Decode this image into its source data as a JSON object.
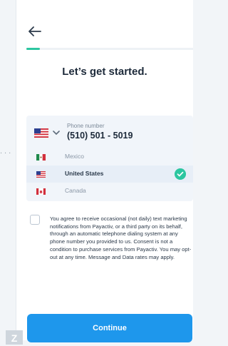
{
  "header": {
    "title": "Let’s get started."
  },
  "progress": {
    "fraction": 0.08
  },
  "phone": {
    "label": "Phone number",
    "value": "(510) 501 - 5019",
    "selected_flag": "us-flag-icon"
  },
  "countries": [
    {
      "name": "Mexico",
      "flag": "mexico-flag-icon",
      "selected": false
    },
    {
      "name": "United States",
      "flag": "us-flag-icon",
      "selected": true
    },
    {
      "name": "Canada",
      "flag": "canada-flag-icon",
      "selected": false
    }
  ],
  "consent": {
    "text": "You agree to receive occasional (not daily) text marketing notifications from Payactiv, or a third party on its behalf, through an automatic telephone dialing system at any phone number you provided to us. Consent is not a condition to purchase services from Payactiv. You may opt-out at any time. Message and Data rates may apply."
  },
  "actions": {
    "continue_label": "Continue"
  },
  "brand": {
    "logo_glyph": "Z"
  },
  "colors": {
    "accent": "#1e97ec",
    "success": "#2cc6a0"
  }
}
